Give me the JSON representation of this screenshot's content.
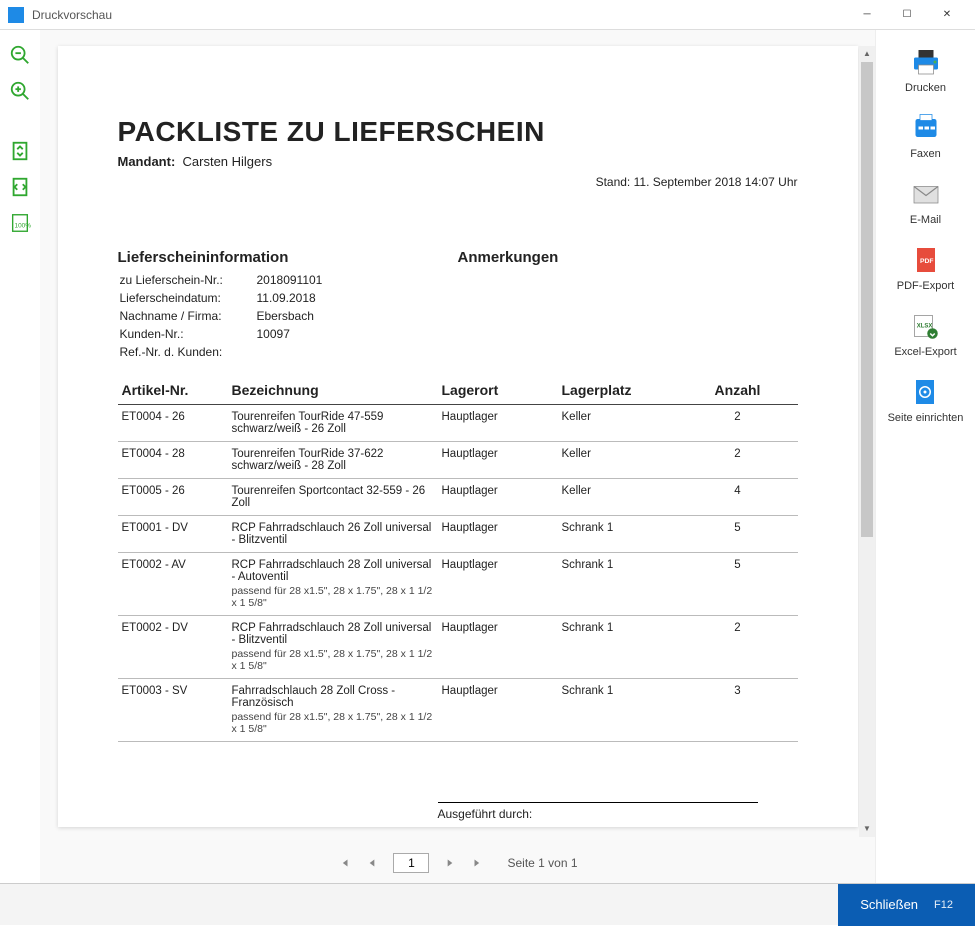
{
  "window": {
    "title": "Druckvorschau"
  },
  "left_toolbar": {
    "zoom_out": "zoom-out",
    "zoom_in": "zoom-in",
    "fit_page": "fit-page",
    "fit_width": "fit-width",
    "zoom_100": "100%"
  },
  "right_toolbar": {
    "print": "Drucken",
    "fax": "Faxen",
    "email": "E-Mail",
    "pdf": "PDF-Export",
    "excel": "Excel-Export",
    "setup": "Seite einrichten"
  },
  "pager": {
    "current": "1",
    "info": "Seite 1 von 1"
  },
  "footer": {
    "close": "Schließen",
    "shortcut": "F12"
  },
  "doc": {
    "title": "PACKLISTE ZU LIEFERSCHEIN",
    "mandant_label": "Mandant:",
    "mandant_value": "Carsten Hilgers",
    "stand_label": "Stand:",
    "stand_value": "11. September 2018 14:07 Uhr",
    "info_header": "Lieferscheininformation",
    "notes_header": "Anmerkungen",
    "info": [
      {
        "k": "zu Lieferschein-Nr.:",
        "v": "2018091101"
      },
      {
        "k": "Lieferscheindatum:",
        "v": "11.09.2018"
      },
      {
        "k": "Nachname / Firma:",
        "v": "Ebersbach"
      },
      {
        "k": "Kunden-Nr.:",
        "v": "10097"
      },
      {
        "k": "Ref.-Nr. d. Kunden:",
        "v": ""
      }
    ],
    "cols": {
      "artikel": "Artikel-Nr.",
      "bezeichnung": "Bezeichnung",
      "lagerort": "Lagerort",
      "lagerplatz": "Lagerplatz",
      "anzahl": "Anzahl"
    },
    "rows": [
      {
        "nr": "ET0004 - 26",
        "desc": "Tourenreifen TourRide 47-559 schwarz/weiß - 26 Zoll",
        "sub": "",
        "ort": "Hauptlager",
        "platz": "Keller",
        "qty": "2"
      },
      {
        "nr": "ET0004 - 28",
        "desc": "Tourenreifen TourRide 37-622 schwarz/weiß - 28 Zoll",
        "sub": "",
        "ort": "Hauptlager",
        "platz": "Keller",
        "qty": "2"
      },
      {
        "nr": "ET0005 - 26",
        "desc": "Tourenreifen Sportcontact 32-559  - 26 Zoll",
        "sub": "",
        "ort": "Hauptlager",
        "platz": "Keller",
        "qty": "4"
      },
      {
        "nr": "ET0001 - DV",
        "desc": "RCP Fahrradschlauch 26 Zoll universal - Blitzventil",
        "sub": "",
        "ort": "Hauptlager",
        "platz": "Schrank 1",
        "qty": "5"
      },
      {
        "nr": "ET0002 - AV",
        "desc": "RCP Fahrradschlauch 28 Zoll universal - Autoventil",
        "sub": "passend für 28 x1.5\", 28 x 1.75\", 28 x 1 1/2 x 1 5/8\"",
        "ort": "Hauptlager",
        "platz": "Schrank 1",
        "qty": "5"
      },
      {
        "nr": "ET0002 - DV",
        "desc": "RCP Fahrradschlauch 28 Zoll universal - Blitzventil",
        "sub": "passend für 28 x1.5\", 28 x 1.75\", 28 x 1 1/2 x 1 5/8\"",
        "ort": "Hauptlager",
        "platz": "Schrank 1",
        "qty": "2"
      },
      {
        "nr": "ET0003 - SV",
        "desc": "Fahrradschlauch 28 Zoll Cross - Französisch",
        "sub": "passend für 28 x1.5\", 28 x 1.75\", 28 x 1 1/2 x 1 5/8\"",
        "ort": "Hauptlager",
        "platz": "Schrank 1",
        "qty": "3"
      }
    ],
    "signature": "Ausgeführt durch:"
  }
}
